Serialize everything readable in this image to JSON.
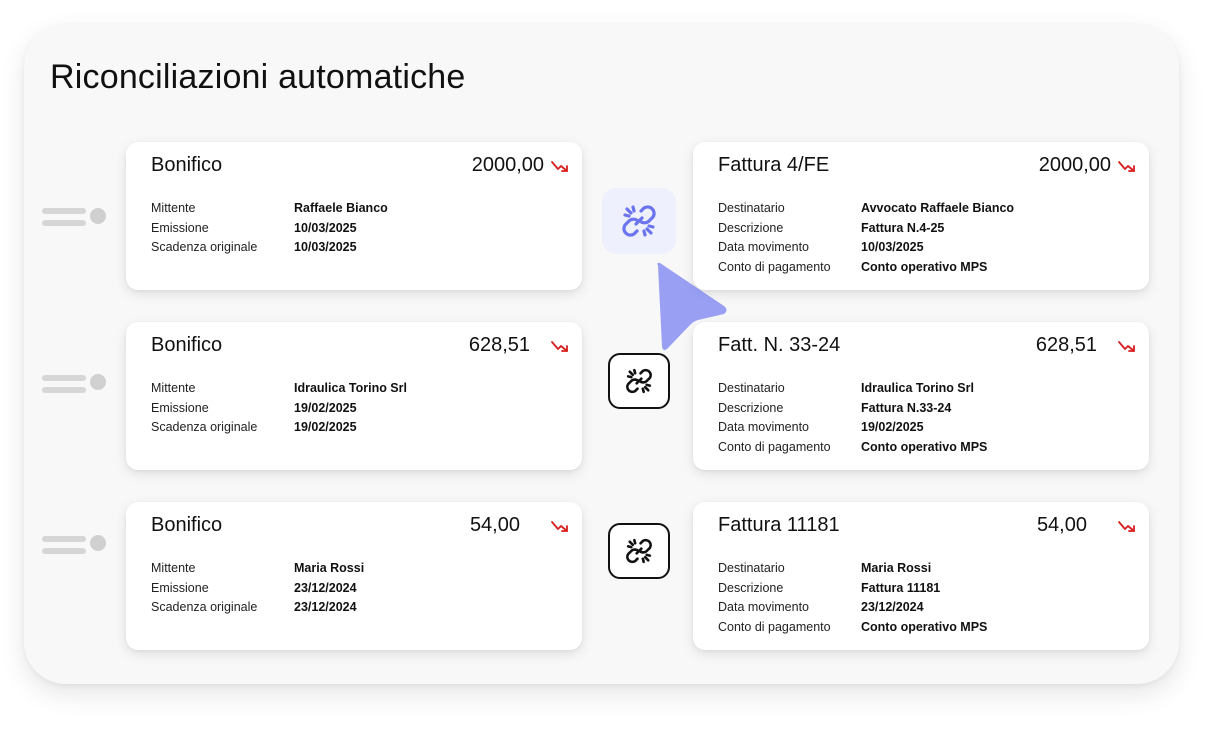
{
  "title": "Riconciliazioni automatiche",
  "colors": {
    "accent": "#6b74ef",
    "trend_down": "#d81e1e",
    "link_active_bg": "#eef0fd"
  },
  "icons": {
    "trend": "trend-down-icon",
    "link": "link-icon",
    "cursor": "cursor-pointer-icon",
    "handle": "drag-handle-icon"
  },
  "pairs": [
    {
      "left": {
        "title": "Bonifico",
        "amount": "2000,00",
        "rows": [
          {
            "label": "Mittente",
            "value": "Raffaele Bianco"
          },
          {
            "label": "Emissione",
            "value": "10/03/2025"
          },
          {
            "label": "Scadenza originale",
            "value": "10/03/2025"
          }
        ]
      },
      "right": {
        "title": "Fattura 4/FE",
        "amount": "2000,00",
        "rows": [
          {
            "label": "Destinatario",
            "value": "Avvocato Raffaele Bianco"
          },
          {
            "label": "Descrizione",
            "value": "Fattura N.4-25"
          },
          {
            "label": "Data movimento",
            "value": "10/03/2025"
          },
          {
            "label": "Conto di pagamento",
            "value": "Conto operativo MPS"
          }
        ]
      },
      "link_state": "active"
    },
    {
      "left": {
        "title": "Bonifico",
        "amount": "628,51",
        "rows": [
          {
            "label": "Mittente",
            "value": "Idraulica Torino Srl"
          },
          {
            "label": "Emissione",
            "value": "19/02/2025"
          },
          {
            "label": "Scadenza originale",
            "value": "19/02/2025"
          }
        ]
      },
      "right": {
        "title": "Fatt. N. 33-24",
        "amount": "628,51",
        "rows": [
          {
            "label": "Destinatario",
            "value": "Idraulica Torino Srl"
          },
          {
            "label": "Descrizione",
            "value": "Fattura N.33-24"
          },
          {
            "label": "Data movimento",
            "value": "19/02/2025"
          },
          {
            "label": "Conto di pagamento",
            "value": "Conto operativo MPS"
          }
        ]
      },
      "link_state": "outline"
    },
    {
      "left": {
        "title": "Bonifico",
        "amount": "54,00",
        "rows": [
          {
            "label": "Mittente",
            "value": "Maria Rossi"
          },
          {
            "label": "Emissione",
            "value": "23/12/2024"
          },
          {
            "label": "Scadenza originale",
            "value": "23/12/2024"
          }
        ]
      },
      "right": {
        "title": "Fattura 11181",
        "amount": "54,00",
        "rows": [
          {
            "label": "Destinatario",
            "value": "Maria Rossi"
          },
          {
            "label": "Descrizione",
            "value": "Fattura 11181"
          },
          {
            "label": "Data movimento",
            "value": "23/12/2024"
          },
          {
            "label": "Conto di pagamento",
            "value": "Conto operativo MPS"
          }
        ]
      },
      "link_state": "outline"
    }
  ]
}
